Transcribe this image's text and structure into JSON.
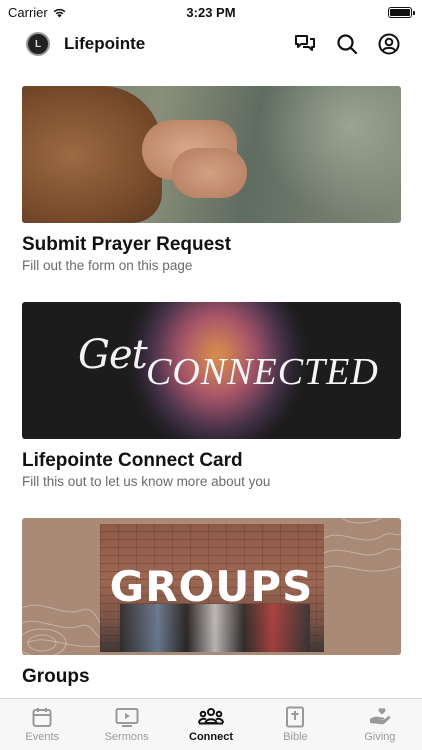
{
  "status_bar": {
    "carrier": "Carrier",
    "time": "3:23 PM",
    "battery_level": 1.0
  },
  "header": {
    "logo_text": "L",
    "title": "Lifepointe",
    "icons": [
      "chat-icon",
      "search-icon",
      "profile-icon"
    ]
  },
  "cards": [
    {
      "title": "Submit Prayer Request",
      "subtitle": "Fill out the form on this page",
      "image": "praying-hands-photo"
    },
    {
      "title": "Lifepointe Connect Card",
      "subtitle": "Fill this out to let us know more about you",
      "image": "get-connected-graphic",
      "image_text_script": "Get",
      "image_text_caps": "CONNECTED"
    },
    {
      "title": "Groups",
      "subtitle": "",
      "image": "groups-graphic",
      "image_text": "GROUPS"
    }
  ],
  "tabs": [
    {
      "label": "Events",
      "icon": "calendar-icon",
      "active": false
    },
    {
      "label": "Sermons",
      "icon": "tv-play-icon",
      "active": false
    },
    {
      "label": "Connect",
      "icon": "people-icon",
      "active": true
    },
    {
      "label": "Bible",
      "icon": "bible-icon",
      "active": false
    },
    {
      "label": "Giving",
      "icon": "giving-hand-icon",
      "active": false
    }
  ],
  "colors": {
    "active_tab": "#111111",
    "inactive_tab": "#9a9a9a",
    "subtitle": "#6b6b6b",
    "tab_bar_bg": "#f7f7f7"
  }
}
